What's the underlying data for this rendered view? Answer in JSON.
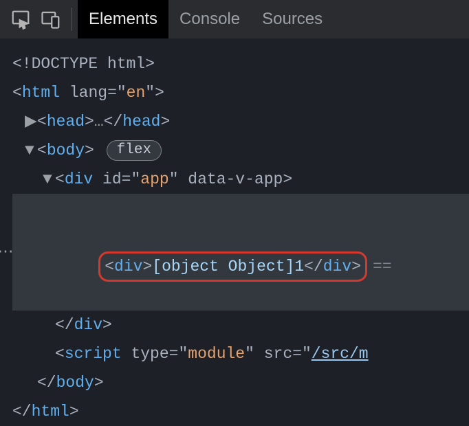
{
  "toolbar": {
    "inspect_tooltip": "Select an element",
    "device_tooltip": "Toggle device toolbar"
  },
  "tabs": {
    "elements": "Elements",
    "console": "Console",
    "sources": "Sources"
  },
  "dom": {
    "doctype": "<!DOCTYPE html>",
    "html_open_tag": "html",
    "html_lang_attr": "lang",
    "html_lang_val": "en",
    "head_tag": "head",
    "head_ellipsis": "…",
    "body_tag": "body",
    "body_badge": "flex",
    "div_app_tag": "div",
    "div_app_id_attr": "id",
    "div_app_id_val": "app",
    "div_app_data_attr": "data-v-app",
    "hl_div_tag": "div",
    "hl_text": "[object Object]1",
    "script_tag": "script",
    "script_type_attr": "type",
    "script_type_val": "module",
    "script_src_attr": "src",
    "script_src_val": "/src/m",
    "eq_selector": "=="
  }
}
